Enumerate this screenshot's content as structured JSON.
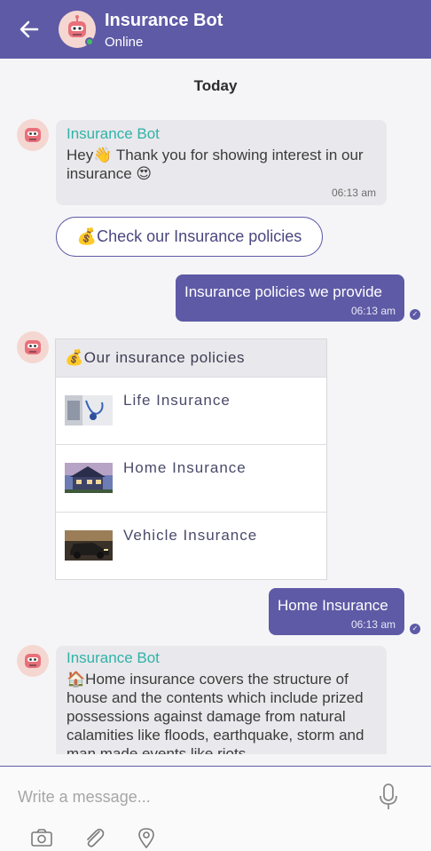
{
  "header": {
    "title": "Insurance Bot",
    "status": "Online"
  },
  "day_label": "Today",
  "messages": [
    {
      "sender": "Insurance Bot",
      "text": "Hey👋 Thank you for showing interest in our insurance 😍",
      "time": "06:13 am"
    },
    {
      "quick_reply": "💰Check our Insurance policies"
    },
    {
      "user_text": "Insurance policies we provide",
      "time": "06:13 am"
    },
    {
      "card_title": "💰Our insurance policies",
      "items": [
        {
          "label": "Life Insurance",
          "icon": "stethoscope-laptop-image"
        },
        {
          "label": "Home Insurance",
          "icon": "house-image"
        },
        {
          "label": "Vehicle Insurance",
          "icon": "car-image"
        }
      ]
    },
    {
      "user_text": "Home Insurance",
      "time": "06:13 am"
    },
    {
      "sender": "Insurance Bot",
      "text": "🏠Home insurance covers the structure of house and the contents which include prized possessions against damage from natural calamities like floods, earthquake, storm and man made events like riots"
    }
  ],
  "composer": {
    "placeholder": "Write a message..."
  },
  "colors": {
    "brand": "#5e5aa6",
    "sender": "#2fb3a8",
    "online": "#3fbf5f"
  }
}
